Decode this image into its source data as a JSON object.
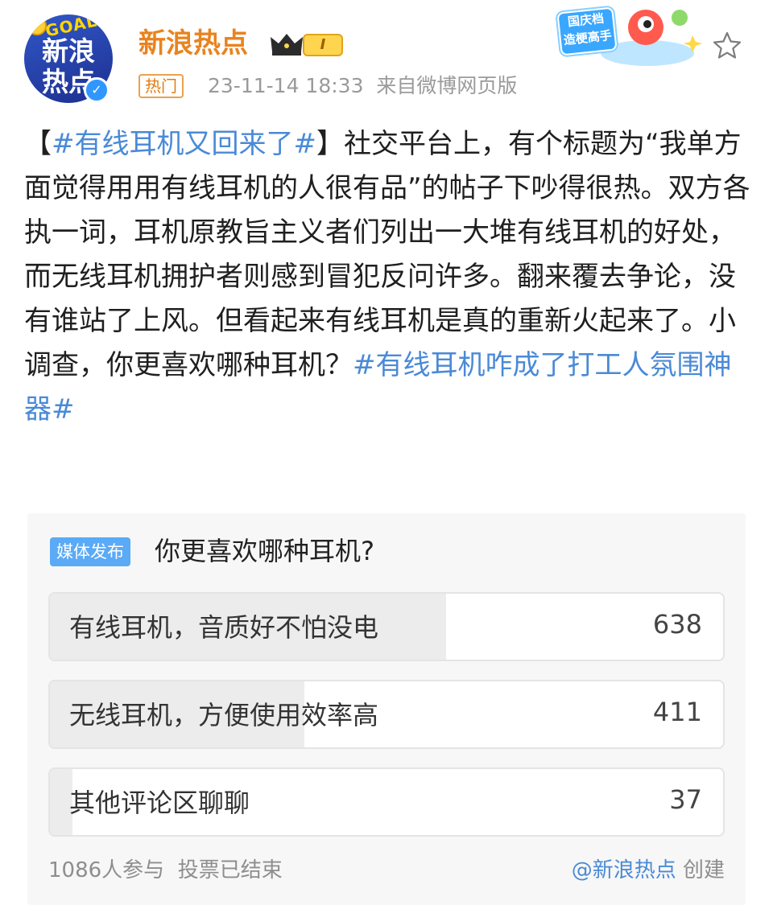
{
  "header": {
    "avatar_line1": "新浪",
    "avatar_line2": "热点",
    "avatar_badge_text": "GOAL",
    "verified_icon": "verified-icon",
    "username": "新浪热点",
    "crown_icon": "crown-icon",
    "level": "I",
    "hot_tag": "热门",
    "timestamp": "23-11-14 18:33",
    "source": "来自微博网页版",
    "promo_text_line1": "国庆档",
    "promo_text_line2": "造梗高手",
    "favorite_icon": "star-icon"
  },
  "post": {
    "open_bracket": "【",
    "topic1": "#有线耳机又回来了#",
    "close_bracket": "】",
    "body": "社交平台上，有个标题为“我单方面觉得用用有线耳机的人很有品”的帖子下吵得很热。双方各执一词，耳机原教旨主义者们列出一大堆有线耳机的好处，而无线耳机拥护者则感到冒犯反问许多。翻来覆去争论，没有谁站了上风。但看起来有线耳机是真的重新火起来了。小调查，你更喜欢哪种耳机？",
    "topic2": "#有线耳机咋成了打工人氛围神器#"
  },
  "poll": {
    "badge": "媒体发布",
    "question": "你更喜欢哪种耳机?",
    "options": [
      {
        "label": "有线耳机，音质好不怕没电",
        "count": "638",
        "share": 0.588
      },
      {
        "label": "无线耳机，方便使用效率高",
        "count": "411",
        "share": 0.378
      },
      {
        "label": "其他评论区聊聊",
        "count": "37",
        "share": 0.034
      }
    ],
    "participants": "1086人参与",
    "status": "投票已结束",
    "creator_mention": "@新浪热点",
    "creator_suffix": " 创建"
  },
  "colors": {
    "username": "#e9831f",
    "topic": "#4a8ad6",
    "badge": "#5aaaf5",
    "poll_bg": "#f7f7f7"
  }
}
